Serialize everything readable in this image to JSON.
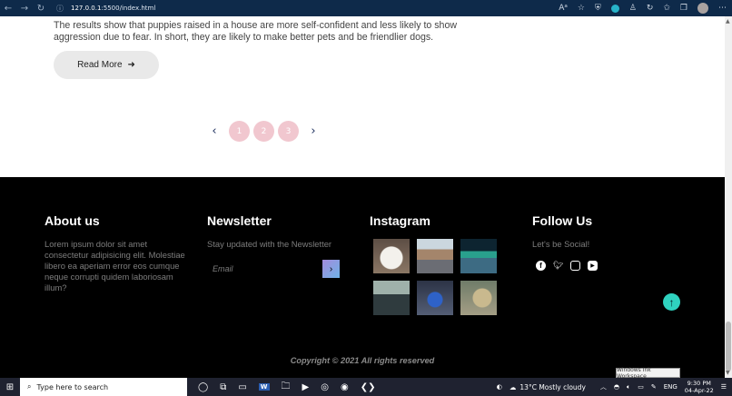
{
  "browser": {
    "address_info_icon": "info-circle-icon",
    "url_host": "127.0.0.1",
    "url_path": ":5500/index.html",
    "back_icon": "arrow-left-icon",
    "forward_icon": "arrow-right-icon",
    "refresh_icon": "refresh-icon"
  },
  "article": {
    "excerpt": "The results show that puppies raised in a house are more self-confident and less likely to show aggression due to fear. In short, they are likely to make better pets and be friendlier dogs.",
    "read_more": "Read More"
  },
  "pagination": {
    "pages": [
      "1",
      "2",
      "3"
    ]
  },
  "footer": {
    "about": {
      "title": "About us",
      "text": "Lorem ipsum dolor sit amet consectetur adipisicing elit. Molestiae libero ea aperiam error eos cumque neque corrupti quidem laboriosam illum?"
    },
    "newsletter": {
      "title": "Newsletter",
      "text": "Stay updated with the Newsletter",
      "placeholder": "Email"
    },
    "instagram": {
      "title": "Instagram"
    },
    "follow": {
      "title": "Follow Us",
      "text": "Let's be Social!"
    },
    "copyright": "Copyright © 2021 All rights reserved"
  },
  "taskbar": {
    "search_placeholder": "Type here to search",
    "weather": "13°C  Mostly cloudy",
    "language": "ENG",
    "time": "9:30 PM",
    "date": "04-Apr-22"
  },
  "tooltip": {
    "text": "Windows Ink Workspace"
  },
  "colors": {
    "pager_bubble": "#f1c7cf",
    "footer_bg": "#000000",
    "to_top_button": "#2fd2bf",
    "browser_bar": "#0e2a4a"
  }
}
